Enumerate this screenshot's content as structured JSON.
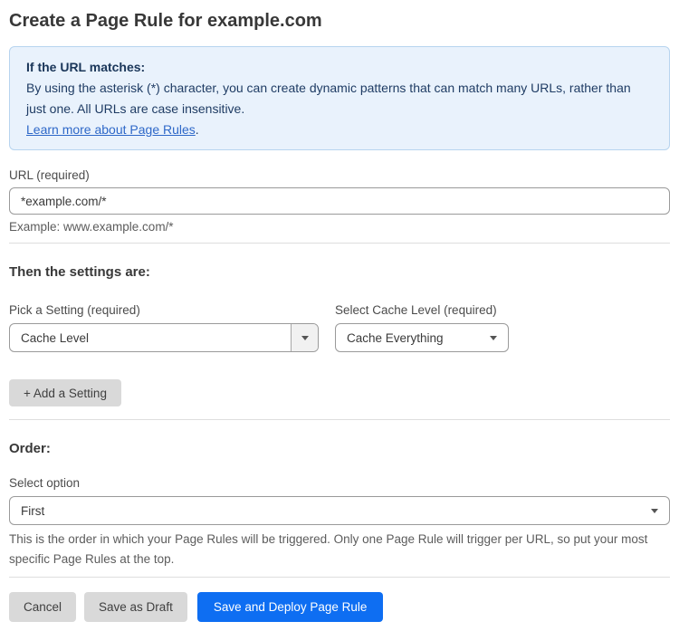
{
  "page": {
    "title": "Create a Page Rule for example.com"
  },
  "info_box": {
    "heading": "If the URL matches:",
    "body": "By using the asterisk (*) character, you can create dynamic patterns that can match many URLs, rather than just one. All URLs are case insensitive.",
    "link_label": "Learn more about Page Rules",
    "link_suffix": "."
  },
  "url_field": {
    "label": "URL (required)",
    "value": "*example.com/*",
    "helper": "Example: www.example.com/*"
  },
  "settings_section": {
    "heading": "Then the settings are:",
    "setting_select": {
      "label": "Pick a Setting (required)",
      "value": "Cache Level"
    },
    "cache_level_select": {
      "label": "Select Cache Level (required)",
      "value": "Cache Everything"
    },
    "add_setting_label": "+ Add a Setting"
  },
  "order_section": {
    "heading": "Order:",
    "select_label": "Select option",
    "selected_option": "First",
    "helper": "This is the order in which your Page Rules will be triggered. Only one Page Rule will trigger per URL, so put your most specific Page Rules at the top."
  },
  "actions": {
    "cancel_label": "Cancel",
    "save_draft_label": "Save as Draft",
    "save_deploy_label": "Save and Deploy Page Rule"
  },
  "colors": {
    "accent_blue": "#0e6ef2",
    "info_bg": "#e9f2fc",
    "info_border": "#b7d4ef",
    "info_text": "#1f3c64",
    "link_blue": "#2e68c8",
    "button_gray": "#d9d9d9"
  }
}
